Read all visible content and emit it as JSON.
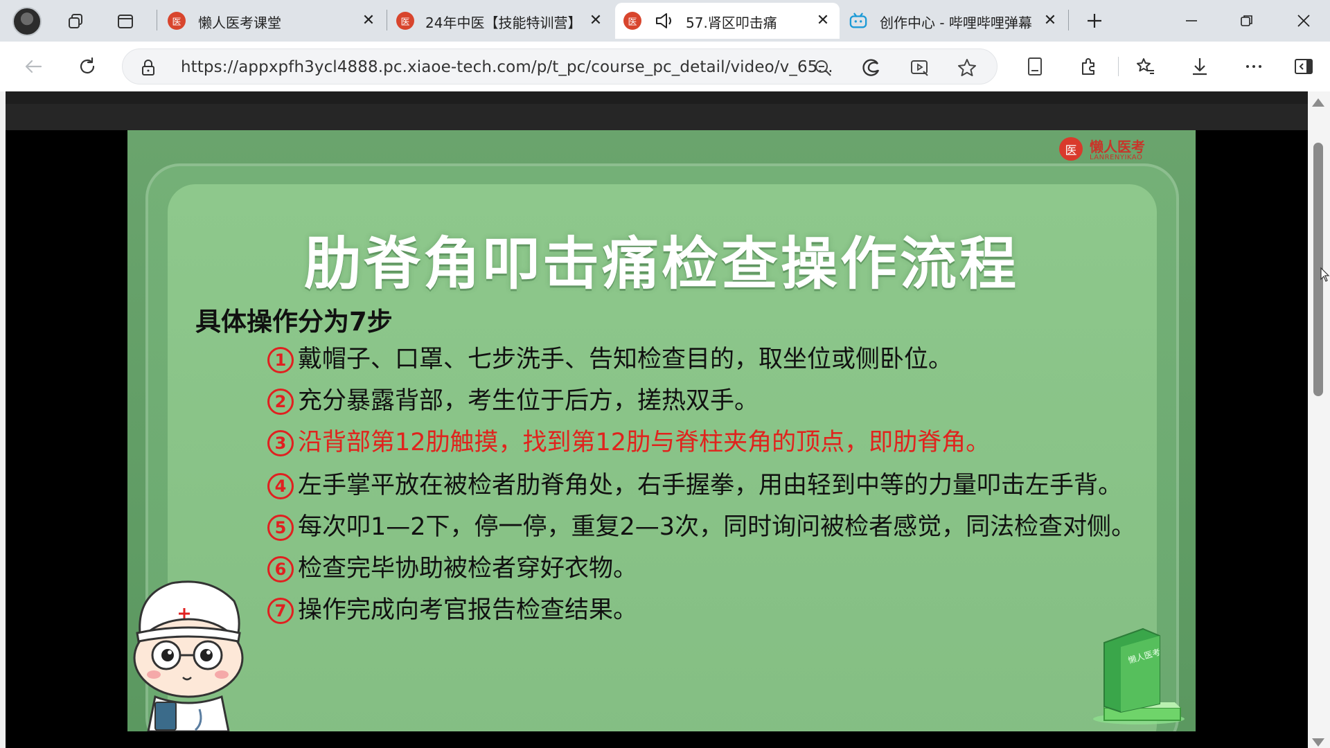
{
  "browser": {
    "tabs": [
      {
        "title": "懒人医考课堂",
        "favicon": "lanren-favicon",
        "active": false
      },
      {
        "title": "24年中医【技能特训营】",
        "favicon": "lanren-favicon",
        "active": false
      },
      {
        "title": "57.肾区叩击痛",
        "favicon": "lanren-favicon",
        "active": true,
        "audio": true
      },
      {
        "title": "创作中心 - 哔哩哔哩弹幕",
        "favicon": "bilibili-favicon",
        "active": false
      }
    ],
    "tab_favicon_glyph": "医",
    "url": "https://appxpfh3ycl4888.pc.xiaoe-tech.com/p/t_pc/course_pc_detail/video/v_65..."
  },
  "slide": {
    "brand_name": "懒人医考",
    "brand_sub": "LANRENYIKAO",
    "brand_glyph": "医",
    "title": "肋脊角叩击痛检查操作流程",
    "subtitle": "具体操作分为7步",
    "steps": [
      {
        "num": "1",
        "text": "戴帽子、口罩、七步洗手、告知检查目的，取坐位或侧卧位。",
        "highlight": false
      },
      {
        "num": "2",
        "text": "充分暴露背部，考生位于后方，搓热双手。",
        "highlight": false
      },
      {
        "num": "3",
        "text": "沿背部第12肋触摸，找到第12肋与脊柱夹角的顶点，即肋脊角。",
        "highlight": true
      },
      {
        "num": "4",
        "text": "左手掌平放在被检者肋脊角处，右手握拳，用由轻到中等的力量叩击左手背。",
        "highlight": false
      },
      {
        "num": "5",
        "text": "每次叩1—2下，停一停，重复2—3次，同时询问被检者感觉，同法检查对侧。",
        "highlight": false
      },
      {
        "num": "6",
        "text": "检查完毕协助被检者穿好衣物。",
        "highlight": false
      },
      {
        "num": "7",
        "text": "操作完成向考官报告检查结果。",
        "highlight": false
      }
    ],
    "book_label": "懒人医考"
  },
  "colors": {
    "slide_green": "#6aa46d",
    "panel_green": "#8ec88c",
    "highlight_red": "#e0231d",
    "brand_red": "#d93a2c"
  }
}
